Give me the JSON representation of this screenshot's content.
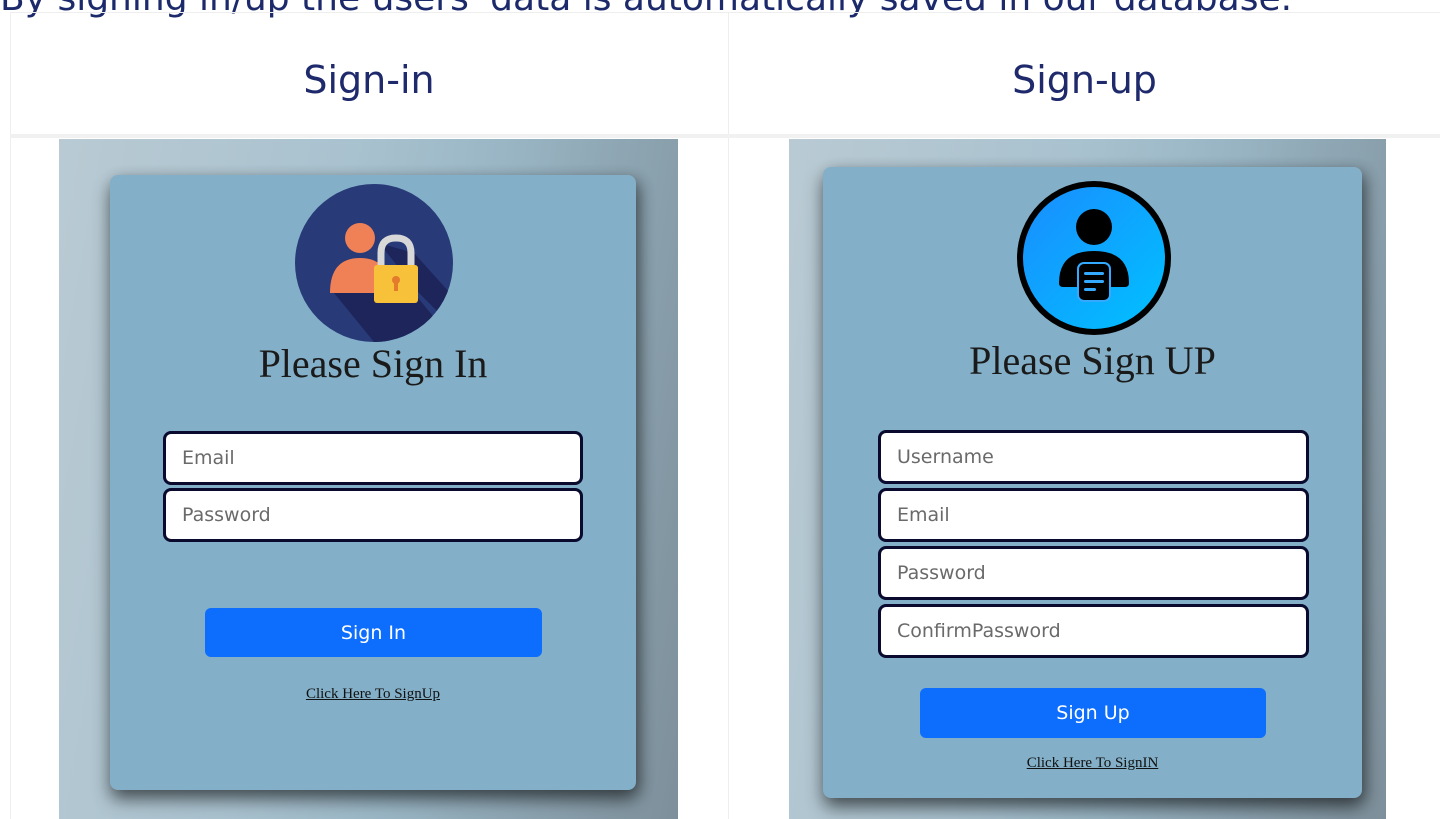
{
  "caption": "By signing in/up the users' data is automatically saved in our database.",
  "columns": {
    "signin_header": "Sign-in",
    "signup_header": "Sign-up"
  },
  "signin": {
    "title": "Please Sign In",
    "fields": {
      "email_placeholder": "Email",
      "password_placeholder": "Password"
    },
    "button_label": "Sign In",
    "link_text": "Click Here To SignUp",
    "icon": "user-lock-icon"
  },
  "signup": {
    "title": "Please Sign UP",
    "fields": {
      "username_placeholder": "Username",
      "email_placeholder": "Email",
      "password_placeholder": "Password",
      "confirm_placeholder": "ConfirmPassword"
    },
    "button_label": "Sign Up",
    "link_text": "Click Here To SignIN",
    "icon": "user-document-icon"
  },
  "colors": {
    "heading": "#1e2a6c",
    "card": "#83b0c8",
    "button": "#0d6efd"
  }
}
